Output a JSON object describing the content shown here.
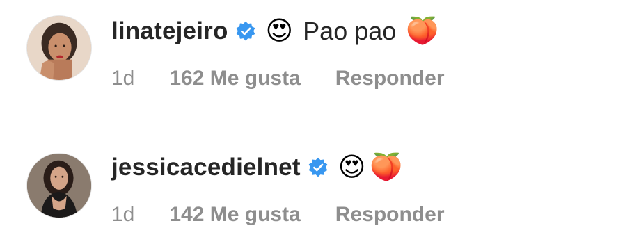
{
  "colors": {
    "text": "#262626",
    "meta": "#8e8e8e",
    "verified": "#3897f0"
  },
  "comments": [
    {
      "username": "linatejeiro",
      "verified_icon": "verified-badge-icon",
      "emoji_before": "😍",
      "text": "Pao pao",
      "emoji_after": "🍑",
      "time": "1d",
      "likes": "162 Me gusta",
      "reply": "Responder"
    },
    {
      "username": "jessicacedielnet",
      "verified_icon": "verified-badge-icon",
      "emoji_1": "😍",
      "emoji_2": "🍑",
      "time": "1d",
      "likes": "142 Me gusta",
      "reply": "Responder"
    }
  ]
}
